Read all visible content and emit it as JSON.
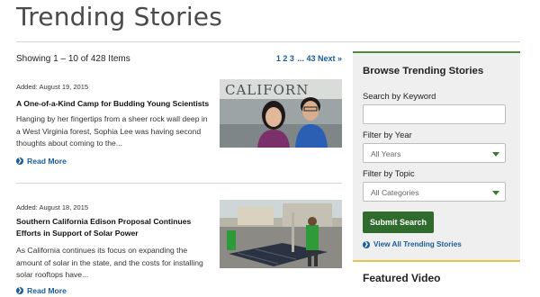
{
  "page": {
    "title": "Trending Stories"
  },
  "results": {
    "showing": "Showing 1 – 10 of 428 Items",
    "pages": [
      "1",
      "2",
      "3",
      "...",
      "43",
      "Next »"
    ]
  },
  "stories": [
    {
      "added": "Added: August 19, 2015",
      "title": "A One-of-a-Kind Camp for Budding Young Scientists",
      "excerpt": "Hanging by her fingertips from a sheer rock wall deep in a West Virginia forest, Sophia Lee was having second thoughts about coming to the...",
      "read_more": "Read More",
      "image_sign_text": "CALIFORN"
    },
    {
      "added": "Added: August 18, 2015",
      "title": "Southern California Edison Proposal Continues Efforts in Support of Solar Power",
      "excerpt": "As California continues its focus on expanding the amount of solar in the state, and the costs for installing solar rooftops have...",
      "read_more": "Read More"
    }
  ],
  "sidebar": {
    "heading": "Browse Trending Stories",
    "keyword_label": "Search by Keyword",
    "keyword_value": "",
    "year_label": "Filter by Year",
    "year_value": "All Years",
    "topic_label": "Filter by Topic",
    "topic_value": "All Categories",
    "submit_label": "Submit Search",
    "view_all": "View All Trending Stories"
  },
  "featured": {
    "heading": "Featured Video"
  },
  "colors": {
    "accent_green": "#2e6b2d",
    "link_blue": "#1a5c99",
    "featured_rule": "#e8c44a"
  }
}
